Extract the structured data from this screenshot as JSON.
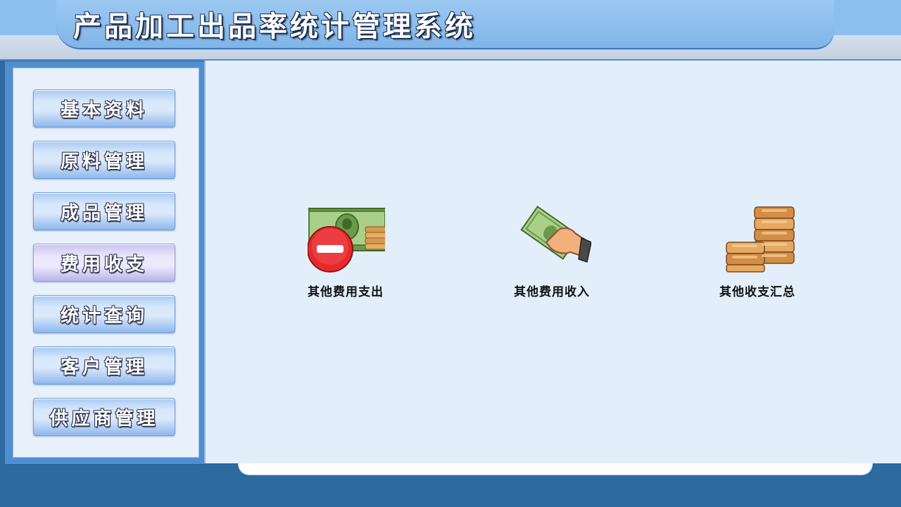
{
  "header": {
    "title": "产品加工出品率统计管理系统"
  },
  "sidebar": {
    "items": [
      {
        "label": "基本资料"
      },
      {
        "label": "原料管理"
      },
      {
        "label": "成品管理"
      },
      {
        "label": "费用收支",
        "active": true
      },
      {
        "label": "统计查询"
      },
      {
        "label": "客户管理"
      },
      {
        "label": "供应商管理"
      }
    ]
  },
  "main": {
    "actions": [
      {
        "label": "其他费用支出",
        "icon": "money-minus-icon"
      },
      {
        "label": "其他费用收入",
        "icon": "money-hand-icon"
      },
      {
        "label": "其他收支汇总",
        "icon": "coins-stack-icon"
      }
    ]
  },
  "colors": {
    "header_blue": "#8cbfee",
    "sidebar_blue": "#4f8fd1",
    "panel_bg": "#e3eefb",
    "footer_blue": "#2c6aa0",
    "active_button": "#e8e5fb"
  }
}
